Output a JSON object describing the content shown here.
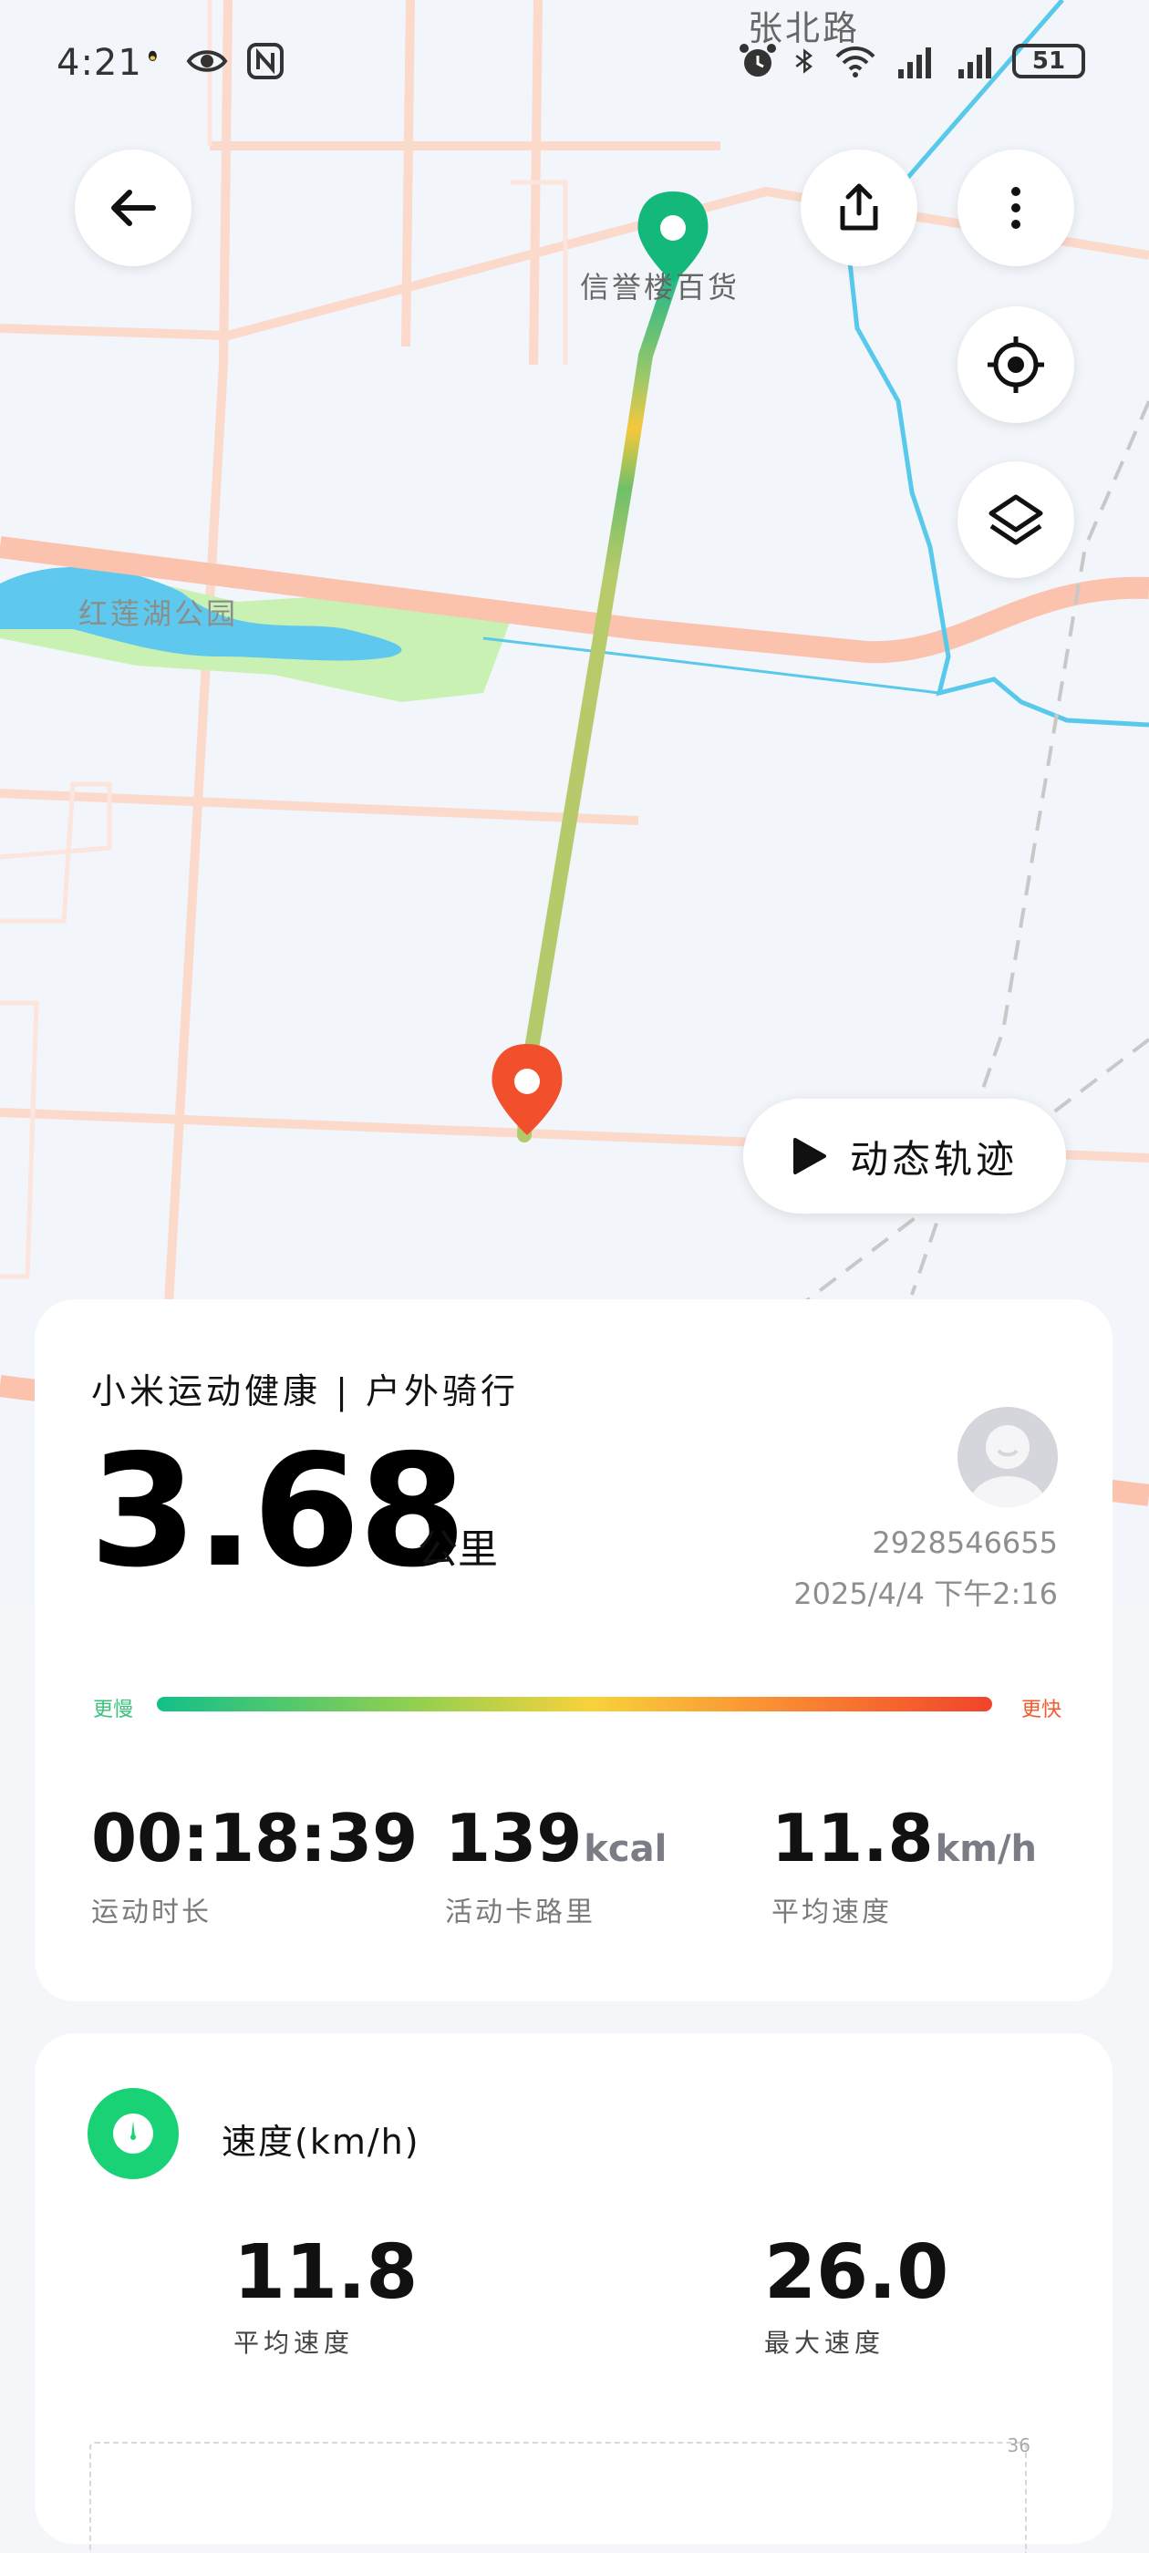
{
  "status_bar": {
    "time": "4:21",
    "battery": "51"
  },
  "map": {
    "place_labels": {
      "north_village": "张北路",
      "store": "信誉楼百货",
      "park": "红莲湖公园"
    },
    "replay_label": "动态轨迹"
  },
  "summary": {
    "title": "小米运动健康 | 户外骑行",
    "distance": "3.68",
    "distance_unit": "公里",
    "user_id": "2928546655",
    "date": "2025/4/4  下午2:16",
    "pace_slow_label": "更慢",
    "pace_fast_label": "更快",
    "metrics": [
      {
        "value": "00:18:39",
        "unit": "",
        "label": "运动时长"
      },
      {
        "value": "139",
        "unit": "kcal",
        "label": "活动卡路里"
      },
      {
        "value": "11.8",
        "unit": "km/h",
        "label": "平均速度"
      }
    ]
  },
  "speed_card": {
    "title": "速度(km/h)",
    "avg": {
      "value": "11.8",
      "label": "平均速度"
    },
    "max": {
      "value": "26.0",
      "label": "最大速度"
    },
    "tick": "36"
  },
  "colors": {
    "start_marker": "#14b87a",
    "end_marker": "#f2502c",
    "speed_icon_bg": "#18d275"
  }
}
